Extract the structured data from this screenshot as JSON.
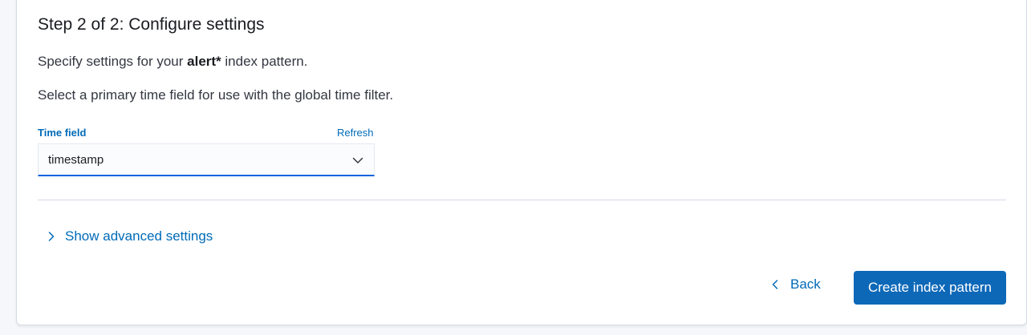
{
  "step": {
    "title": "Step 2 of 2: Configure settings",
    "specify_prefix": "Specify settings for your ",
    "pattern_name": "alert*",
    "specify_suffix": " index pattern.",
    "instruction": "Select a primary time field for use with the global time filter."
  },
  "time_field": {
    "label": "Time field",
    "refresh_label": "Refresh",
    "selected_value": "timestamp",
    "icon": "chevron-down-icon"
  },
  "advanced": {
    "label": "Show advanced settings",
    "icon": "chevron-right-icon"
  },
  "footer": {
    "back_label": "Back",
    "back_icon": "chevron-left-icon",
    "create_label": "Create index pattern"
  },
  "colors": {
    "accent": "#006bb8",
    "primary_button": "#0d68b8",
    "focus_underline": "#0b64dd"
  }
}
